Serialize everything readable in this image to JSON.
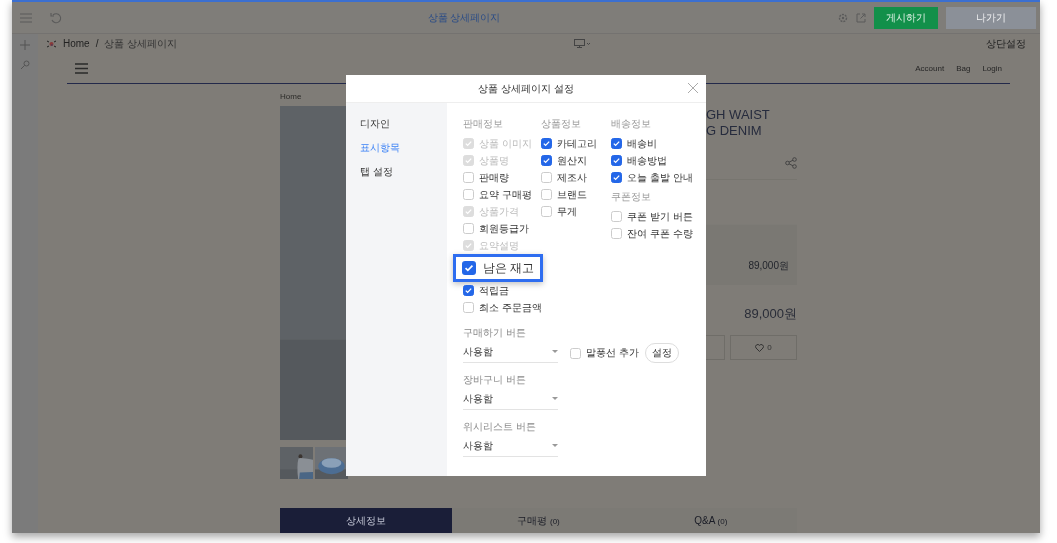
{
  "editor_bar": {
    "title": "상품 상세페이지",
    "buttons": [
      {
        "label": "게시하기",
        "kind": "primary"
      },
      {
        "label": "나가기",
        "kind": "secondary"
      }
    ]
  },
  "sub_bar": {
    "breadcrumb": [
      "Home",
      "상품 상세페이지"
    ],
    "separator": "/",
    "right_link": "상단설정"
  },
  "site_header": {
    "nav": [
      "Account",
      "Bag",
      "Login"
    ]
  },
  "product": {
    "breadcrumb": "Home",
    "title_lines": [
      "GH WAIST",
      "G DENIM"
    ],
    "option_price": "89,000원",
    "total_price": "89,000원",
    "wish_count": "0",
    "tabs": [
      {
        "label": "상세정보",
        "selected": true
      },
      {
        "label": "구매평",
        "count": "(0)",
        "selected": false
      },
      {
        "label": "Q&A",
        "count": "(0)",
        "selected": false
      }
    ]
  },
  "modal": {
    "title": "상품 상세페이지 설정",
    "sidebar": [
      {
        "label": "디자인",
        "selected": false
      },
      {
        "label": "표시항목",
        "selected": true
      },
      {
        "label": "탭 설정",
        "selected": false
      }
    ],
    "columns": [
      {
        "groups": [
          {
            "title": "판매정보",
            "items": [
              {
                "label": "상품 이미지",
                "checked": true,
                "disabled": true,
                "highlighted": false
              },
              {
                "label": "상품명",
                "checked": true,
                "disabled": true,
                "highlighted": false
              },
              {
                "label": "판매량",
                "checked": false,
                "disabled": false,
                "highlighted": false
              },
              {
                "label": "요약 구매평",
                "checked": false,
                "disabled": false,
                "highlighted": false
              },
              {
                "label": "상품가격",
                "checked": true,
                "disabled": true,
                "highlighted": false
              },
              {
                "label": "회원등급가",
                "checked": false,
                "disabled": false,
                "highlighted": false
              },
              {
                "label": "요약설명",
                "checked": true,
                "disabled": true,
                "highlighted": false
              },
              {
                "label": "남은 재고",
                "checked": true,
                "disabled": false,
                "highlighted": true
              },
              {
                "label": "적립금",
                "checked": true,
                "disabled": false,
                "highlighted": false
              },
              {
                "label": "최소 주문금액",
                "checked": false,
                "disabled": false,
                "highlighted": false
              }
            ]
          }
        ]
      },
      {
        "groups": [
          {
            "title": "상품정보",
            "items": [
              {
                "label": "카테고리",
                "checked": true,
                "disabled": false,
                "highlighted": false
              },
              {
                "label": "원산지",
                "checked": true,
                "disabled": false,
                "highlighted": false
              },
              {
                "label": "제조사",
                "checked": false,
                "disabled": false,
                "highlighted": false
              },
              {
                "label": "브랜드",
                "checked": false,
                "disabled": false,
                "highlighted": false
              },
              {
                "label": "무게",
                "checked": false,
                "disabled": false,
                "highlighted": false
              }
            ]
          }
        ]
      },
      {
        "groups": [
          {
            "title": "배송정보",
            "items": [
              {
                "label": "배송비",
                "checked": true,
                "disabled": false,
                "highlighted": false
              },
              {
                "label": "배송방법",
                "checked": true,
                "disabled": false,
                "highlighted": false
              },
              {
                "label": "오늘 출발 안내",
                "checked": true,
                "disabled": false,
                "highlighted": false
              }
            ]
          },
          {
            "title": "쿠폰정보",
            "items": [
              {
                "label": "쿠폰 받기 버튼",
                "checked": false,
                "disabled": false,
                "highlighted": false
              },
              {
                "label": "잔여 쿠폰 수량",
                "checked": false,
                "disabled": false,
                "highlighted": false
              }
            ]
          }
        ]
      }
    ],
    "button_settings": [
      {
        "label": "구매하기 버튼",
        "value": "사용함",
        "balloon": {
          "label": "말풍선 추가",
          "checked": false
        },
        "action": "설정"
      },
      {
        "label": "장바구니 버튼",
        "value": "사용함"
      },
      {
        "label": "위시리스트 버튼",
        "value": "사용함"
      }
    ]
  }
}
